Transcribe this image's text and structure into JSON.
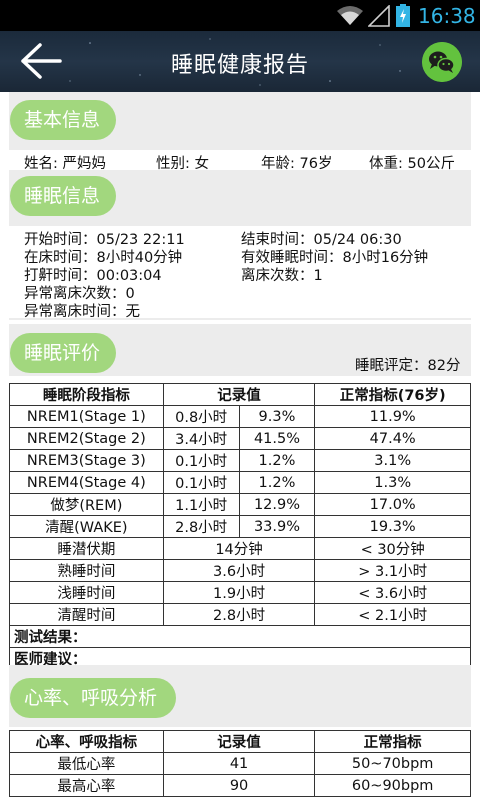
{
  "status_bar": {
    "time": "16:38",
    "time_color": "#33b5e5"
  },
  "header": {
    "title": "睡眠健康报告",
    "back_icon": "back-arrow-icon",
    "share_icon": "wechat-icon"
  },
  "basic": {
    "section_title": "基本信息",
    "name": "姓名: 严妈妈",
    "gender": "性别: 女",
    "age": "年龄: 76岁",
    "weight": "体重: 50公斤"
  },
  "sleep_info": {
    "section_title": "睡眠信息",
    "start": "开始时间：05/23 22:11",
    "end": "结束时间：05/24 06:30",
    "in_bed": "在床时间：8小时40分钟",
    "effective": "有效睡眠时间：8小时16分钟",
    "snore": "打鼾时间：00:03:04",
    "out_bed": "离床次数：1",
    "abnormal_count": "异常离床次数：0",
    "abnormal_time": "异常离床时间：无"
  },
  "evaluation": {
    "section_title": "睡眠评价",
    "score": "睡眠评定：82分",
    "headers": [
      "睡眠阶段指标",
      "记录值",
      "正常指标(76岁)"
    ],
    "stage_rows": [
      [
        "NREM1(Stage 1)",
        "0.8小时",
        "9.3%",
        "11.9%"
      ],
      [
        "NREM2(Stage 2)",
        "3.4小时",
        "41.5%",
        "47.4%"
      ],
      [
        "NREM3(Stage 3)",
        "0.1小时",
        "1.2%",
        "3.1%"
      ],
      [
        "NREM4(Stage 4)",
        "0.1小时",
        "1.2%",
        "1.3%"
      ],
      [
        "做梦(REM)",
        "1.1小时",
        "12.9%",
        "17.0%"
      ],
      [
        "清醒(WAKE)",
        "2.8小时",
        "33.9%",
        "19.3%"
      ]
    ],
    "time_rows": [
      [
        "睡潜伏期",
        "14分钟",
        "< 30分钟"
      ],
      [
        "熟睡时间",
        "3.6小时",
        "> 3.1小时"
      ],
      [
        "浅睡时间",
        "1.9小时",
        "< 3.6小时"
      ],
      [
        "清醒时间",
        "2.8小时",
        "< 2.1小时"
      ]
    ],
    "result_label": "测试结果：",
    "advice_label": "医师建议："
  },
  "heart": {
    "section_title": "心率、呼吸分析",
    "headers": [
      "心率、呼吸指标",
      "记录值",
      "正常指标"
    ],
    "rows": [
      [
        "最低心率",
        "41",
        "50~70bpm"
      ],
      [
        "最高心率",
        "90",
        "60~90bpm"
      ]
    ]
  }
}
